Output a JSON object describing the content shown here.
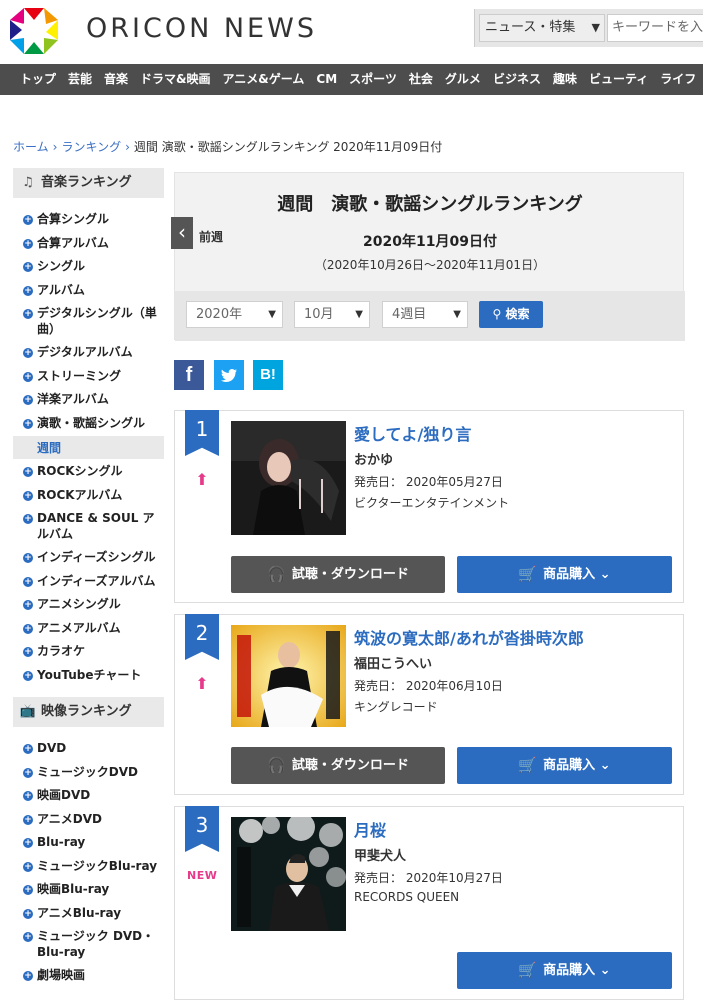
{
  "header": {
    "logo_text": "ORICON NEWS",
    "search_select": "ニュース・特集",
    "search_placeholder": "キーワードを入"
  },
  "nav": [
    "トップ",
    "芸能",
    "音楽",
    "ドラマ&映画",
    "アニメ&ゲーム",
    "CM",
    "スポーツ",
    "社会",
    "グルメ",
    "ビジネス",
    "趣味",
    "ビューティ",
    "ライフ"
  ],
  "breadcrumb": {
    "home": "ホーム",
    "ranking": "ランキング",
    "current": "週間 演歌・歌謡シングルランキング 2020年11月09日付"
  },
  "sidebar": {
    "music_heading": "音楽ランキング",
    "music_items": [
      "合算シングル",
      "合算アルバム",
      "シングル",
      "アルバム",
      "デジタルシングル（単曲）",
      "デジタルアルバム",
      "ストリーミング",
      "洋楽アルバム",
      "演歌・歌謡シングル"
    ],
    "music_sub": "週間",
    "music_items_2": [
      "ROCKシングル",
      "ROCKアルバム",
      "DANCE & SOUL アルバム",
      "インディーズシングル",
      "インディーズアルバム",
      "アニメシングル",
      "アニメアルバム",
      "カラオケ",
      "YouTubeチャート"
    ],
    "video_heading": "映像ランキング",
    "video_items": [
      "DVD",
      "ミュージックDVD",
      "映画DVD",
      "アニメDVD",
      "Blu-ray",
      "ミュージックBlu-ray",
      "映画Blu-ray",
      "アニメBlu-ray",
      "ミュージック DVD・Blu-ray",
      "劇場映画"
    ]
  },
  "main": {
    "title": "週間　演歌・歌謡シングルランキング",
    "date": "2020年11月09日付",
    "range": "（2020年10月26日～2020年11月01日）",
    "prev_label": "前週",
    "filters": {
      "year": "2020年",
      "month": "10月",
      "week": "4週目",
      "search_button": "検索"
    }
  },
  "social": {
    "facebook": "f",
    "twitter": "t",
    "hatena": "B!"
  },
  "ranking": [
    {
      "rank": "1",
      "trend": "up",
      "title": "愛してよ/独り言",
      "artist": "おかゆ",
      "release_label": "発売日：",
      "release_date": "2020年05月27日",
      "label": "ビクターエンタテインメント",
      "listen_button": "試聴・ダウンロード",
      "buy_button": "商品購入"
    },
    {
      "rank": "2",
      "trend": "up",
      "title": "筑波の寛太郎/あれが沓掛時次郎",
      "artist": "福田こうへい",
      "release_label": "発売日：",
      "release_date": "2020年06月10日",
      "label": "キングレコード",
      "listen_button": "試聴・ダウンロード",
      "buy_button": "商品購入"
    },
    {
      "rank": "3",
      "trend": "NEW",
      "title": "月桜",
      "artist": "甲斐犬人",
      "release_label": "発売日：",
      "release_date": "2020年10月27日",
      "label": "RECORDS QUEEN",
      "buy_button": "商品購入"
    }
  ],
  "colors": {
    "accent": "#2c6cc0",
    "nav_bg": "#4d4d4d",
    "trend": "#e63b8a"
  }
}
